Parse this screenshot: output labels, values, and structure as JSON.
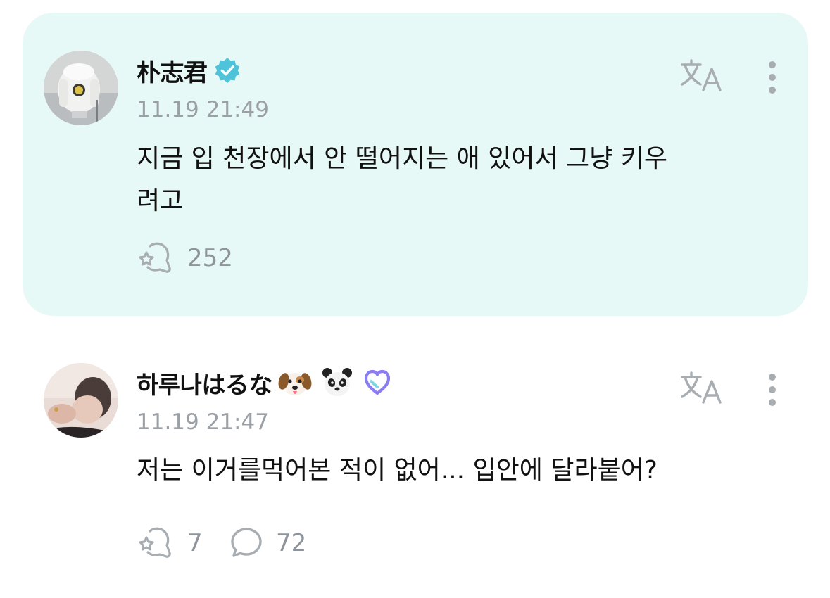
{
  "posts": [
    {
      "username": "朴志君",
      "verified": true,
      "timestamp": "11.19 21:49",
      "body_line1": "지금 입 천장에서 안 떨어지는 애 있어서 그냥 키우",
      "body_line2": "려고",
      "reactions": "252",
      "icons": [
        "verified-badge-icon",
        "translate-icon",
        "more-options-icon",
        "reaction-icon"
      ],
      "highlight_color": "#e7f9f6"
    },
    {
      "username": "하루나はるな",
      "timestamp": "11.19 21:47",
      "body": "저는 이거를먹어본 적이 없어... 입안에 달라붙어?",
      "reactions": "7",
      "comments": "72",
      "icons": [
        "dog-emoji-icon",
        "panda-emoji-icon",
        "heart-badge-icon",
        "translate-icon",
        "more-options-icon",
        "reaction-icon",
        "comment-icon"
      ]
    }
  ],
  "colors": {
    "text": "#111111",
    "muted": "#9aa0a6",
    "verified": "#4fc3d9",
    "heart_badge": "#8a7cf2"
  }
}
